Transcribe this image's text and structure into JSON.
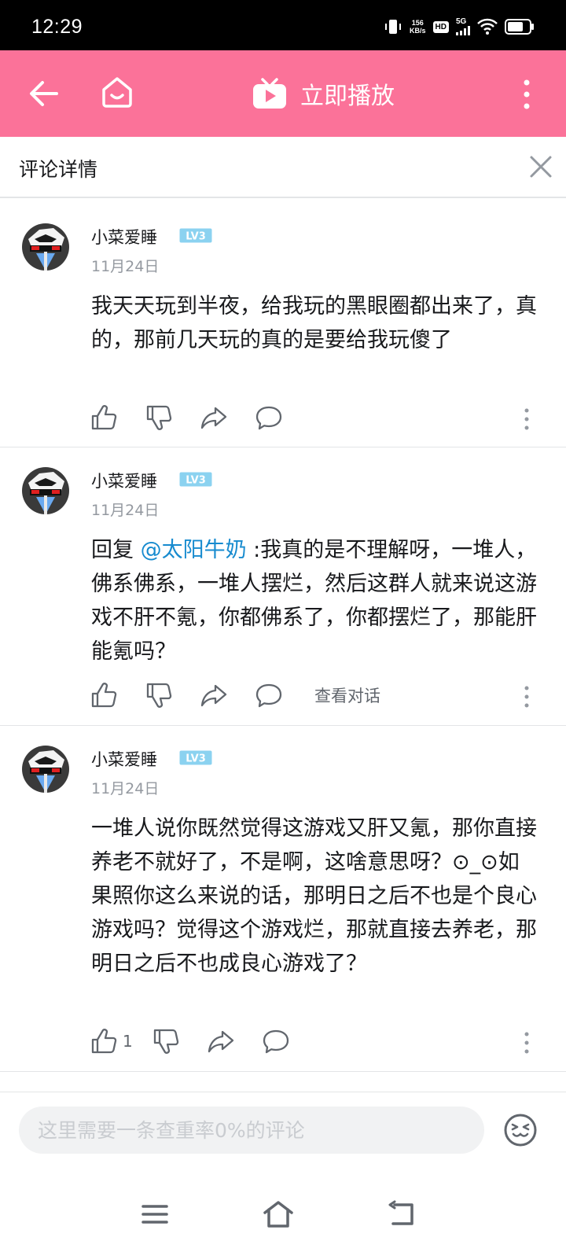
{
  "status_bar": {
    "time": "12:29",
    "net_speed_value": "156",
    "net_speed_unit": "KB/s",
    "hd_badge": "HD",
    "network": "5G"
  },
  "top_bar": {
    "play_label": "立即播放",
    "color": "#fb7299"
  },
  "detail": {
    "title": "评论详情"
  },
  "comments": [
    {
      "user": "小菜爱睡",
      "level": "LV3",
      "date": "11月24日",
      "text": "我天天玩到半夜，给我玩的黑眼圈都出来了，真的，那前几天玩的真的是要给我玩傻了",
      "likes": ""
    },
    {
      "user": "小菜爱睡",
      "level": "LV3",
      "date": "11月24日",
      "reply_prefix": "回复 ",
      "mention": "@太阳牛奶",
      "text": " :我真的是不理解呀，一堆人，佛系佛系，一堆人摆烂，然后这群人就来说这游戏不肝不氪，你都佛系了，你都摆烂了，那能肝能氪吗？",
      "view_conversation": "查看对话",
      "likes": ""
    },
    {
      "user": "小菜爱睡",
      "level": "LV3",
      "date": "11月24日",
      "text": "一堆人说你既然觉得这游戏又肝又氪，那你直接养老不就好了，不是啊，这啥意思呀？⊙_⊙如果照你这么来说的话，那明日之后不也是个良心游戏吗？觉得这个游戏烂，那就直接去养老，那明日之后不也成良心游戏了？",
      "likes": "1"
    }
  ],
  "input": {
    "placeholder": "这里需要一条查重率0%的评论"
  },
  "colors": {
    "accent": "#fb7299",
    "mention": "#178bcf",
    "level_badge": "#8bd2f0"
  }
}
